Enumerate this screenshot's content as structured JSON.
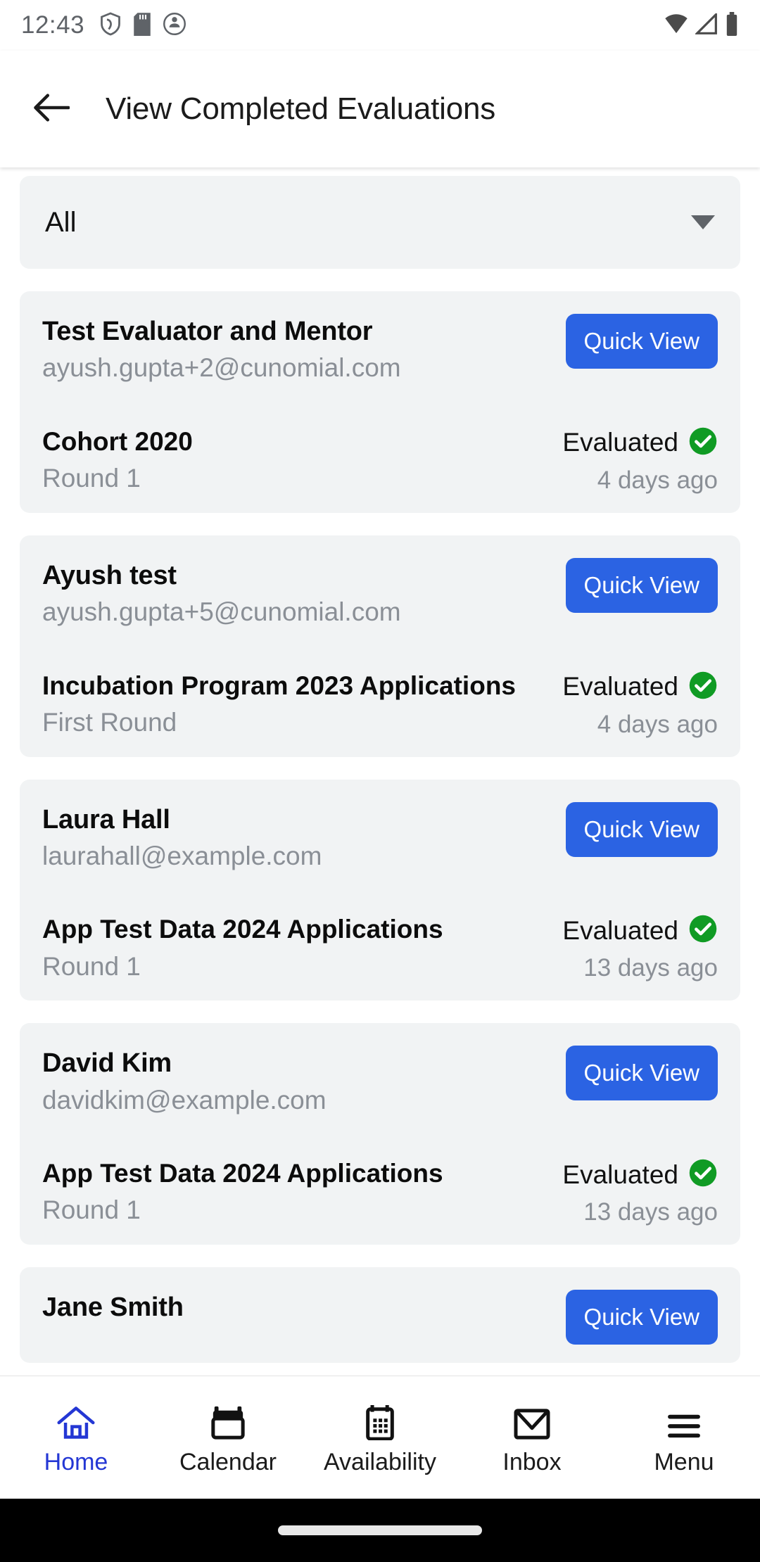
{
  "status_bar": {
    "time": "12:43",
    "left_icons": [
      "shield-icon",
      "sd-card-icon",
      "app-circle-icon"
    ],
    "right_icons": [
      "wifi-icon",
      "signal-icon",
      "battery-icon"
    ]
  },
  "app_bar": {
    "back_icon": "arrow-back-icon",
    "title": "View Completed Evaluations"
  },
  "filter": {
    "selected": "All",
    "caret_icon": "chevron-down-icon"
  },
  "colors": {
    "accent_blue": "#2b63e3",
    "active_nav": "#2437d4",
    "status_green": "#109b24",
    "card_bg": "#f1f3f4",
    "muted_text": "#8a8f96"
  },
  "evaluations": [
    {
      "name": "Test Evaluator and Mentor",
      "email": "ayush.gupta+2@cunomial.com",
      "action_label": "Quick View",
      "program": "Cohort 2020",
      "round": "Round 1",
      "status": "Evaluated",
      "status_icon": "check-circle-icon",
      "time_ago": "4 days ago"
    },
    {
      "name": "Ayush test",
      "email": "ayush.gupta+5@cunomial.com",
      "action_label": "Quick View",
      "program": "Incubation Program 2023 Applications",
      "round": "First Round",
      "status": "Evaluated",
      "status_icon": "check-circle-icon",
      "time_ago": "4 days ago"
    },
    {
      "name": "Laura Hall",
      "email": "laurahall@example.com",
      "action_label": "Quick View",
      "program": "App Test Data 2024 Applications",
      "round": "Round 1",
      "status": "Evaluated",
      "status_icon": "check-circle-icon",
      "time_ago": "13 days ago"
    },
    {
      "name": "David Kim",
      "email": "davidkim@example.com",
      "action_label": "Quick View",
      "program": "App Test Data 2024 Applications",
      "round": "Round 1",
      "status": "Evaluated",
      "status_icon": "check-circle-icon",
      "time_ago": "13 days ago"
    },
    {
      "name": "Jane Smith",
      "email": "",
      "action_label": "Quick View",
      "program": "",
      "round": "",
      "status": "",
      "status_icon": "check-circle-icon",
      "time_ago": ""
    }
  ],
  "bottom_nav": {
    "items": [
      {
        "label": "Home",
        "icon": "home-icon",
        "active": true
      },
      {
        "label": "Calendar",
        "icon": "calendar-icon",
        "active": false
      },
      {
        "label": "Availability",
        "icon": "availability-icon",
        "active": false
      },
      {
        "label": "Inbox",
        "icon": "envelope-icon",
        "active": false
      },
      {
        "label": "Menu",
        "icon": "hamburger-icon",
        "active": false
      }
    ]
  }
}
